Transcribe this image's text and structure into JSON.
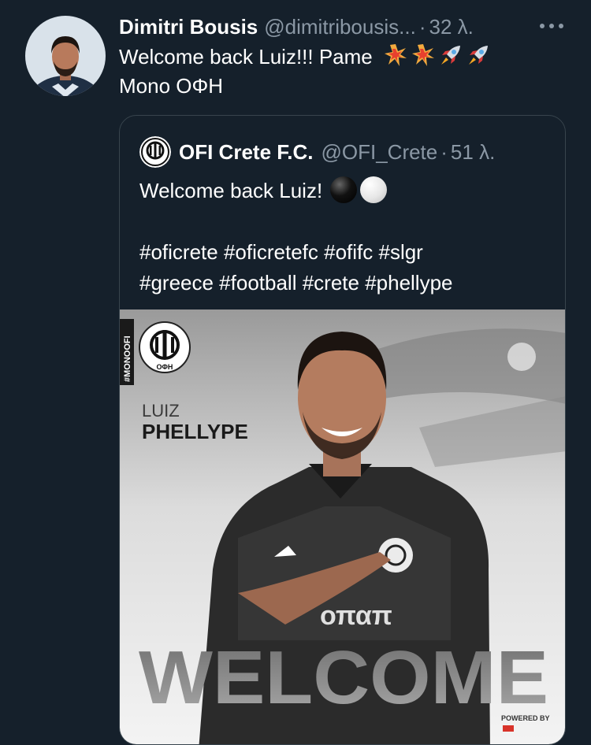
{
  "tweet": {
    "author_name": "Dimitri Bousis",
    "author_handle": "@dimitribousis...",
    "separator": "·",
    "time": "32 λ.",
    "text_line1": "Welcome back Luiz!!! Pame",
    "text_line2": "Mono ΟΦΗ",
    "emojis": [
      "collision-emoji",
      "collision-emoji",
      "rocket-emoji",
      "rocket-emoji"
    ]
  },
  "quoted_tweet": {
    "author_name": "OFI Crete F.C.",
    "author_handle": "@OFI_Crete",
    "separator": "·",
    "time": "51 λ.",
    "text": "Welcome back Luiz!",
    "emojis": [
      "black-circle-emoji",
      "white-circle-emoji"
    ],
    "hashtags_line1": "#oficrete #oficretefc #ofifc #slgr",
    "hashtags_line2": "#greece #football #crete #phellype"
  },
  "media": {
    "side_tag": "#MONOOFI",
    "player_first_name": "LUIZ",
    "player_last_name": "PHELLYPE",
    "headline": "WELCOME",
    "sponsor": "οπαπ",
    "powered_by": "POWERED BY",
    "crest_text": "ΟΦΗ"
  },
  "colors": {
    "background": "#15202b",
    "border": "#38444d",
    "secondary_text": "#8b98a5",
    "primary_text": "#ffffff"
  }
}
